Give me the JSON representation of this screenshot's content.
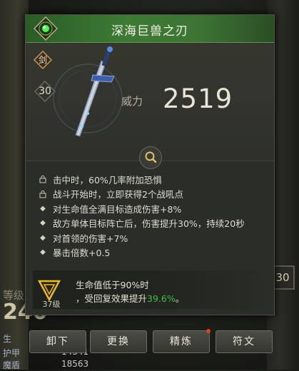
{
  "item": {
    "name": "深海巨兽之刃",
    "type_badge": "剑",
    "level": "30",
    "power_label": "威力",
    "power_value": "2519"
  },
  "effects": [
    {
      "icon": "lock-icon",
      "text": "击中时，60%几率附加恐惧"
    },
    {
      "icon": "lock-icon",
      "text": "战斗开始时，立即获得2个战吼点"
    },
    {
      "icon": "diamond-bullet-icon",
      "text": "对生命值全满目标造成伤害+8%"
    },
    {
      "icon": "diamond-bullet-icon",
      "text": "敌方单体目标阵亡后，伤害提升30%，持续20秒"
    },
    {
      "icon": "diamond-bullet-icon",
      "text": "对首领的伤害+7%"
    },
    {
      "icon": "diamond-bullet-icon",
      "text": "暴击倍数+0.5"
    }
  ],
  "bonus": {
    "level_label": "37级",
    "line1": "生命值低于90%时",
    "line2_prefix": "，受回复效果提升",
    "line2_value": "39.6%",
    "line2_suffix": "。"
  },
  "buttons": {
    "unequip": "卸下",
    "replace": "更换",
    "refine": "精炼",
    "rune": "符文"
  },
  "background": {
    "level_label": "等级",
    "level_value": "240",
    "stats": [
      {
        "label": "生",
        "value": ""
      },
      {
        "label": "护甲",
        "value": "14341"
      },
      {
        "label": "魔盾",
        "value": "18563"
      }
    ],
    "right_badge": "30"
  },
  "colors": {
    "title_bar": "#3d7a34",
    "highlight": "#3fbe4a",
    "notification_dot": "#e63a2a"
  }
}
